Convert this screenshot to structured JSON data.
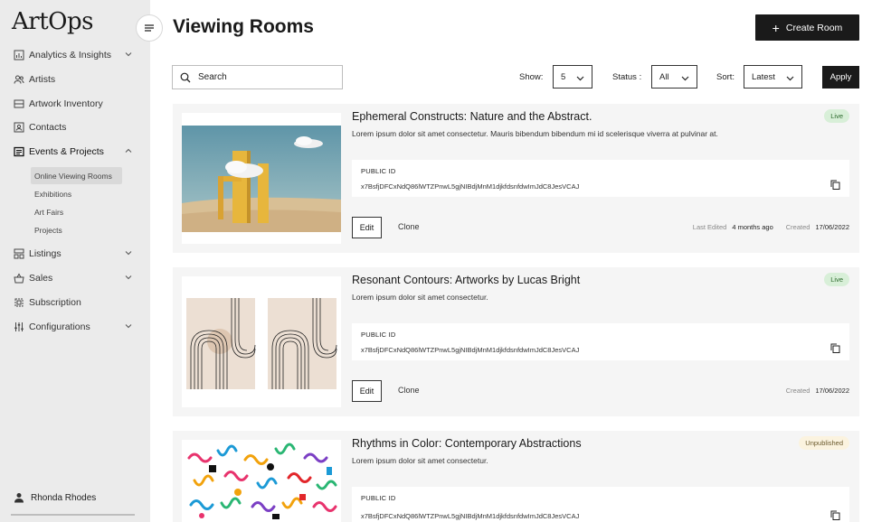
{
  "app": {
    "logo": "ArtOps"
  },
  "sidebar": {
    "items": [
      {
        "label": "Analytics & Insights",
        "icon": "chart-icon",
        "has_chevron": true,
        "chevron": "down"
      },
      {
        "label": "Artists",
        "icon": "users-icon",
        "has_chevron": false
      },
      {
        "label": "Artwork Inventory",
        "icon": "inventory-icon",
        "has_chevron": false
      },
      {
        "label": "Contacts",
        "icon": "contacts-icon",
        "has_chevron": false
      },
      {
        "label": "Events & Projects",
        "icon": "events-icon",
        "has_chevron": true,
        "chevron": "up"
      },
      {
        "label": "Listings",
        "icon": "listings-icon",
        "has_chevron": true,
        "chevron": "down"
      },
      {
        "label": "Sales",
        "icon": "basket-icon",
        "has_chevron": true,
        "chevron": "down"
      },
      {
        "label": "Subscription",
        "icon": "subscription-icon",
        "has_chevron": false
      },
      {
        "label": "Configurations",
        "icon": "sliders-icon",
        "has_chevron": true,
        "chevron": "down"
      }
    ],
    "sub_items": [
      {
        "label": "Online Viewing Rooms",
        "active": true
      },
      {
        "label": "Exhibitions",
        "active": false
      },
      {
        "label": "Art Fairs",
        "active": false
      },
      {
        "label": "Projects",
        "active": false
      }
    ],
    "user": {
      "name": "Rhonda Rhodes"
    }
  },
  "header": {
    "title": "Viewing Rooms",
    "create_label": "Create Room"
  },
  "filters": {
    "search_placeholder": "Search",
    "show_label": "Show:",
    "show_value": "5",
    "status_label": "Status :",
    "status_value": "All",
    "sort_label": "Sort:",
    "sort_value": "Latest",
    "apply_label": "Apply"
  },
  "rooms": [
    {
      "title": "Ephemeral Constructs: Nature and the Abstract.",
      "description": "Lorem ipsum dolor sit amet consectetur. Mauris bibendum bibendum mi id scelerisque viverra at pulvinar at.",
      "status": "Live",
      "public_id_label": "PUBLIC ID",
      "public_id": "x7BsfjDFCxNdQ86lWTZPnwL5gjNIBdjMnM1djkfdsnfdwImJdC8JesVCAJ",
      "edit_label": "Edit",
      "clone_label": "Clone",
      "last_edited_label": "Last Edited",
      "last_edited_value": "4 months ago",
      "created_label": "Created",
      "created_value": "17/06/2022"
    },
    {
      "title": "Resonant Contours: Artworks by Lucas Bright",
      "description": "Lorem ipsum dolor sit amet consectetur.",
      "status": "Live",
      "public_id_label": "PUBLIC ID",
      "public_id": "x7BsfjDFCxNdQ86lWTZPnwL5gjNIBdjMnM1djkfdsnfdwImJdC8JesVCAJ",
      "edit_label": "Edit",
      "clone_label": "Clone",
      "created_label": "Created",
      "created_value": "17/06/2022"
    },
    {
      "title": "Rhythms in Color: Contemporary Abstractions",
      "description": "Lorem ipsum dolor sit amet consectetur.",
      "status": "Unpublished",
      "public_id_label": "PUBLIC ID",
      "public_id": "x7BsfjDFCxNdQ86lWTZPnwL5gjNIBdjMnM1djkfdsnfdwImJdC8JesVCAJ"
    }
  ],
  "colors": {
    "sidebar_bg": "#ebebeb",
    "card_bg": "#f5f5f5",
    "primary": "#1a1a1a",
    "live_badge_bg": "#d8efd8",
    "unpublished_badge_bg": "#fbf3df"
  }
}
